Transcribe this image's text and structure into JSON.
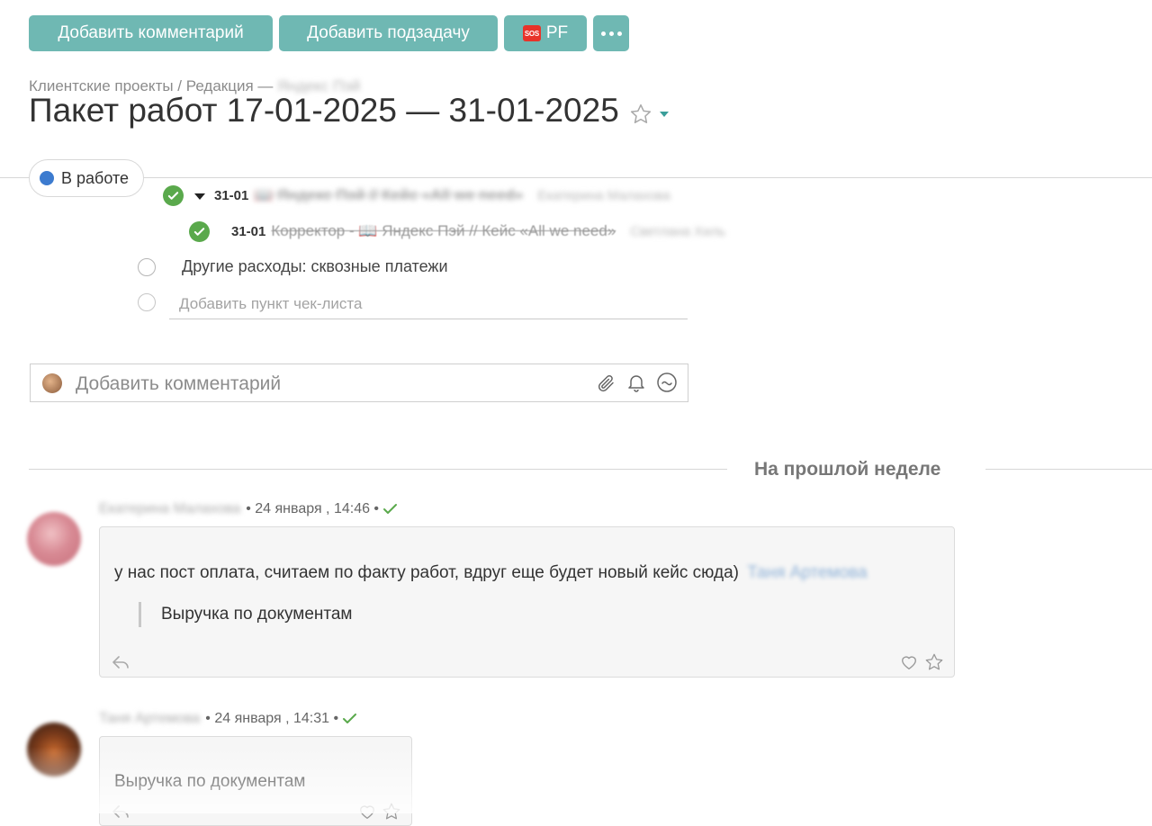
{
  "toolbar": {
    "add_comment": "Добавить комментарий",
    "add_subtask": "Добавить подзадачу",
    "pf_badge": "SOS",
    "pf_label": "PF"
  },
  "breadcrumb": {
    "path": "Клиентские проекты / Редакция —",
    "blurred_project": "Яндекс Пэй"
  },
  "task": {
    "title": "Пакет работ 17-01-2025 — 31-01-2025",
    "status": "В работе",
    "status_color": "#3c7bcf",
    "accent_color": "#6fb8b3"
  },
  "checklist": {
    "items": [
      {
        "date": "31-01",
        "text": "📖 Яндекс Пэй // Кейс «All we need»",
        "assignee": "Екатерина Малахова",
        "done": true
      },
      {
        "date": "31-01",
        "text": "Корректор - 📖 Яндекс Пэй // Кейс «All we need»",
        "assignee": "Светлана Хиль",
        "done": true
      },
      {
        "text": "Другие расходы: сквозные платежи",
        "done": false
      }
    ],
    "add_placeholder": "Добавить пункт чек-листа"
  },
  "comment_input": {
    "placeholder": "Добавить комментарий"
  },
  "feed": {
    "section": "На прошлой неделе",
    "comments": [
      {
        "author": "Екатерина Малахова",
        "time": "• 24 января , 14:46 •",
        "text": "у нас пост оплата, считаем по факту работ, вдруг еще будет новый кейс сюда)",
        "mention": "Таня Артемова",
        "quote": "Выручка по документам"
      },
      {
        "author": "Таня Артемова",
        "time": "• 24 января , 14:31 •",
        "text": "Выручка по документам"
      }
    ]
  }
}
